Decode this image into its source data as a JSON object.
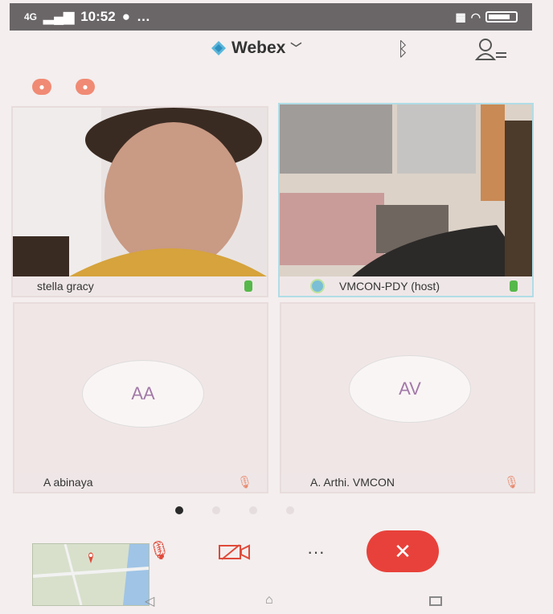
{
  "status_bar": {
    "signal": "4G",
    "time": "10:52",
    "extra": "…"
  },
  "header": {
    "app_name": "Webex"
  },
  "participants": [
    {
      "name": "stella gracy",
      "mic": "on"
    },
    {
      "name": "VMCON-PDY (host)",
      "mic": "on"
    },
    {
      "name": "A abinaya",
      "initials": "AA",
      "mic": "muted"
    },
    {
      "name": "A. Arthi. VMCON",
      "initials": "AV",
      "mic": "muted"
    }
  ],
  "controls": {
    "more_label": "···",
    "end_label": "✕"
  },
  "colors": {
    "end_call": "#e8413b",
    "accent_initials": "#a27aa8",
    "mic_on": "#56b84a"
  },
  "page_indicator": {
    "pages": 4,
    "current": 1
  }
}
